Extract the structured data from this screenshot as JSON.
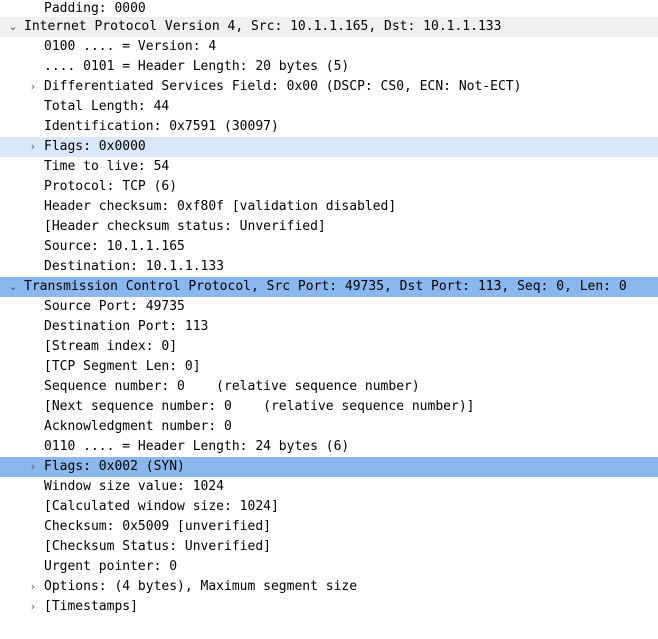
{
  "theme": {
    "selected_bg": "#8ab8ee",
    "highlight_bg": "#d8e8f8",
    "header_bg": "#f0f0f0"
  },
  "rows": [
    {
      "text": "Padding: 0000",
      "level": 1,
      "arrow": "",
      "bg": ""
    },
    {
      "text": "Internet Protocol Version 4, Src: 10.1.1.165, Dst: 10.1.1.133",
      "level": 0,
      "arrow": "expanded",
      "bg": "gray"
    },
    {
      "text": "0100 .... = Version: 4",
      "level": 1,
      "arrow": "",
      "bg": ""
    },
    {
      "text": ".... 0101 = Header Length: 20 bytes (5)",
      "level": 1,
      "arrow": "",
      "bg": ""
    },
    {
      "text": "Differentiated Services Field: 0x00 (DSCP: CS0, ECN: Not-ECT)",
      "level": 1,
      "arrow": "collapsed",
      "bg": ""
    },
    {
      "text": "Total Length: 44",
      "level": 1,
      "arrow": "",
      "bg": ""
    },
    {
      "text": "Identification: 0x7591 (30097)",
      "level": 1,
      "arrow": "",
      "bg": ""
    },
    {
      "text": "Flags: 0x0000",
      "level": 1,
      "arrow": "collapsed",
      "bg": "lightblue"
    },
    {
      "text": "Time to live: 54",
      "level": 1,
      "arrow": "",
      "bg": ""
    },
    {
      "text": "Protocol: TCP (6)",
      "level": 1,
      "arrow": "",
      "bg": ""
    },
    {
      "text": "Header checksum: 0xf80f [validation disabled]",
      "level": 1,
      "arrow": "",
      "bg": ""
    },
    {
      "text": "[Header checksum status: Unverified]",
      "level": 1,
      "arrow": "",
      "bg": ""
    },
    {
      "text": "Source: 10.1.1.165",
      "level": 1,
      "arrow": "",
      "bg": ""
    },
    {
      "text": "Destination: 10.1.1.133",
      "level": 1,
      "arrow": "",
      "bg": ""
    },
    {
      "text": "Transmission Control Protocol, Src Port: 49735, Dst Port: 113, Seq: 0, Len: 0",
      "level": 0,
      "arrow": "expanded",
      "bg": "blue"
    },
    {
      "text": "Source Port: 49735",
      "level": 1,
      "arrow": "",
      "bg": ""
    },
    {
      "text": "Destination Port: 113",
      "level": 1,
      "arrow": "",
      "bg": ""
    },
    {
      "text": "[Stream index: 0]",
      "level": 1,
      "arrow": "",
      "bg": ""
    },
    {
      "text": "[TCP Segment Len: 0]",
      "level": 1,
      "arrow": "",
      "bg": ""
    },
    {
      "text": "Sequence number: 0    (relative sequence number)",
      "level": 1,
      "arrow": "",
      "bg": ""
    },
    {
      "text": "[Next sequence number: 0    (relative sequence number)]",
      "level": 1,
      "arrow": "",
      "bg": ""
    },
    {
      "text": "Acknowledgment number: 0",
      "level": 1,
      "arrow": "",
      "bg": ""
    },
    {
      "text": "0110 .... = Header Length: 24 bytes (6)",
      "level": 1,
      "arrow": "",
      "bg": ""
    },
    {
      "text": "Flags: 0x002 (SYN)",
      "level": 1,
      "arrow": "collapsed",
      "bg": "blue"
    },
    {
      "text": "Window size value: 1024",
      "level": 1,
      "arrow": "",
      "bg": ""
    },
    {
      "text": "[Calculated window size: 1024]",
      "level": 1,
      "arrow": "",
      "bg": ""
    },
    {
      "text": "Checksum: 0x5009 [unverified]",
      "level": 1,
      "arrow": "",
      "bg": ""
    },
    {
      "text": "[Checksum Status: Unverified]",
      "level": 1,
      "arrow": "",
      "bg": ""
    },
    {
      "text": "Urgent pointer: 0",
      "level": 1,
      "arrow": "",
      "bg": ""
    },
    {
      "text": "Options: (4 bytes), Maximum segment size",
      "level": 1,
      "arrow": "collapsed",
      "bg": ""
    },
    {
      "text": "[Timestamps]",
      "level": 1,
      "arrow": "collapsed",
      "bg": ""
    }
  ]
}
